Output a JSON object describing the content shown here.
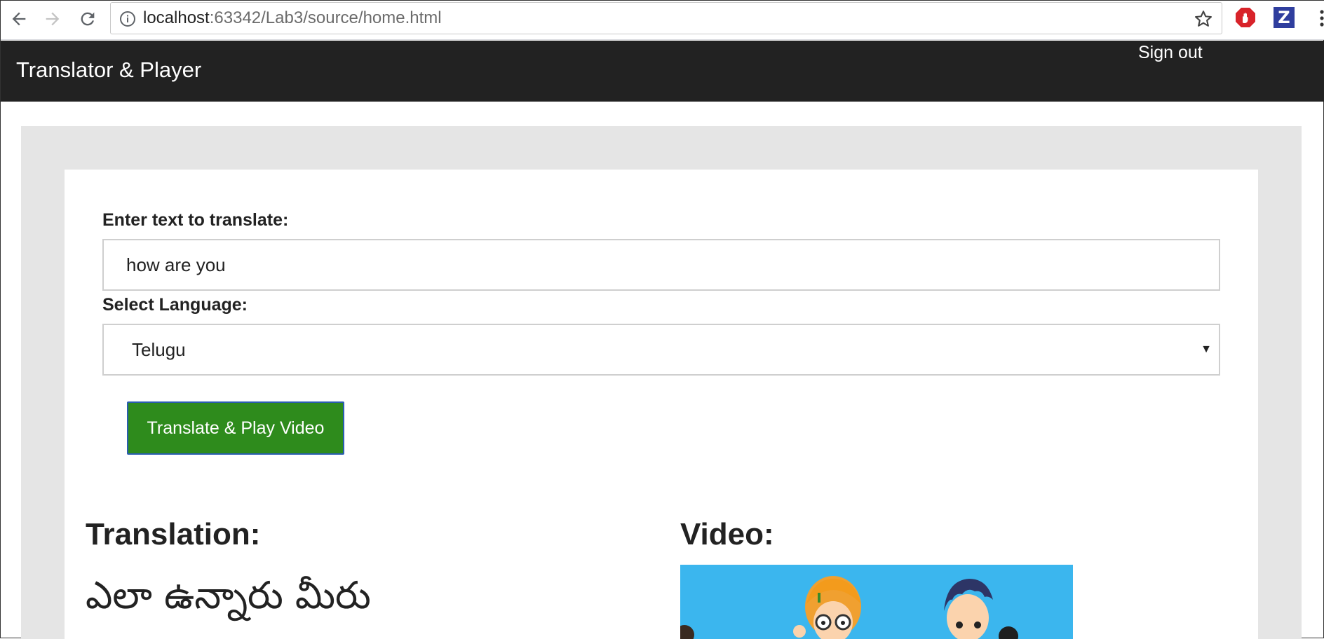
{
  "browser": {
    "url_host": "localhost",
    "url_rest": ":63342/Lab3/source/home.html",
    "extensions": [
      {
        "name": "adblock-icon"
      },
      {
        "name": "z-extension-icon",
        "glyph": "Z"
      }
    ]
  },
  "navbar": {
    "brand": "Translator & Player",
    "signout": "Sign out"
  },
  "form": {
    "text_label": "Enter text to translate:",
    "text_value": "how are you",
    "language_label": "Select Language:",
    "language_selected": "Telugu",
    "submit_label": "Translate & Play Video"
  },
  "results": {
    "translation_heading": "Translation:",
    "translation_text": "ఎలా ఉన్నారు మీరు",
    "video_heading": "Video:"
  },
  "colors": {
    "navbar_bg": "#222222",
    "button_bg": "#2e8b1c",
    "panel_bg": "#e5e5e5",
    "video_bg": "#3bb6ee"
  }
}
